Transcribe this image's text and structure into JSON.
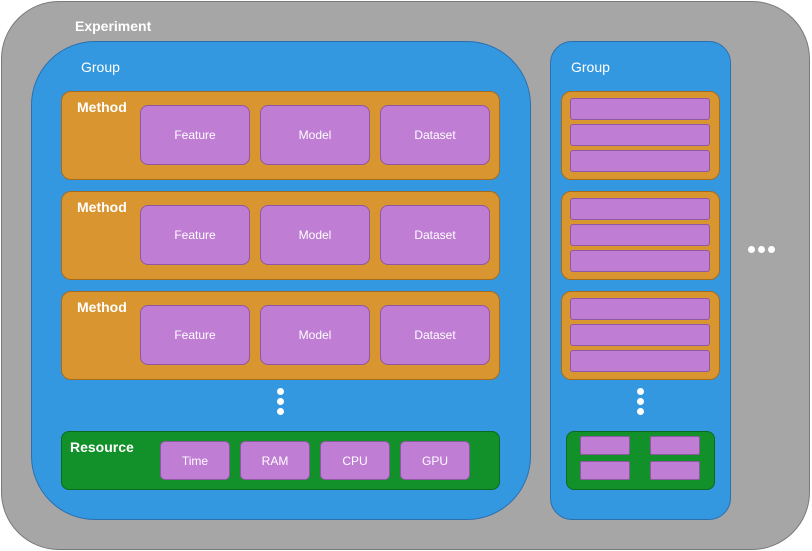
{
  "experiment": {
    "label": "Experiment"
  },
  "group_main": {
    "label": "Group",
    "methods": [
      {
        "label": "Method",
        "items": [
          "Feature",
          "Model",
          "Dataset"
        ]
      },
      {
        "label": "Method",
        "items": [
          "Feature",
          "Model",
          "Dataset"
        ]
      },
      {
        "label": "Method",
        "items": [
          "Feature",
          "Model",
          "Dataset"
        ]
      }
    ],
    "resource": {
      "label": "Resource",
      "items": [
        "Time",
        "RAM",
        "CPU",
        "GPU"
      ]
    }
  },
  "group_side": {
    "label": "Group"
  },
  "colors": {
    "experiment": "#a6a6a6",
    "group": "#3498e0",
    "method": "#d9952f",
    "component": "#bf7dd4",
    "resource": "#12902a"
  }
}
